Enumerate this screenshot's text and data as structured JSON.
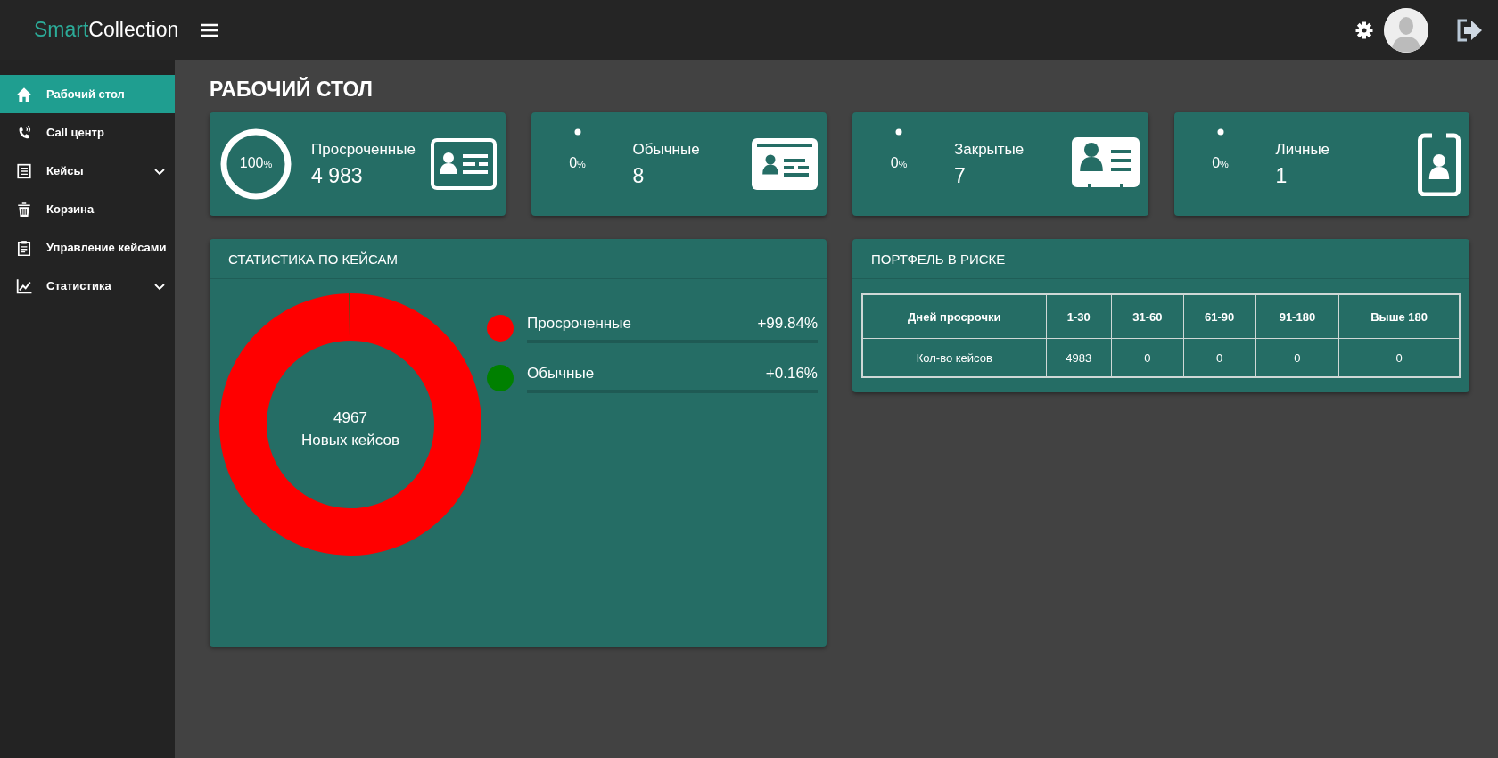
{
  "header": {
    "logo_first": "Smart",
    "logo_second": "Collection"
  },
  "sidebar": {
    "items": [
      {
        "label": "Рабочий стол",
        "kind": "link",
        "selected": true
      },
      {
        "label": "Call центр",
        "kind": "link",
        "selected": false
      },
      {
        "label": "Кейсы",
        "kind": "group",
        "selected": false,
        "expanded": false
      },
      {
        "label": "Корзина",
        "kind": "link",
        "selected": false
      },
      {
        "label": "Управление кейсами",
        "kind": "link",
        "selected": false
      },
      {
        "label": "Статистика",
        "kind": "group",
        "selected": false,
        "expanded": false
      }
    ]
  },
  "page_title": "РАБОЧИЙ СТОЛ",
  "stat_cards": [
    {
      "percent": "100",
      "unit": "%",
      "level": 1,
      "label": "Просроченные",
      "value": "4 983"
    },
    {
      "percent": "0",
      "unit": "%",
      "level": 0,
      "label": "Обычные",
      "value": "8"
    },
    {
      "percent": "0",
      "unit": "%",
      "level": 0,
      "label": "Закрытые",
      "value": "7"
    },
    {
      "percent": "0",
      "unit": "%",
      "level": 0,
      "label": "Личные",
      "value": "1"
    }
  ],
  "case_stats": {
    "title": "СТАТИСТИКА ПО КЕЙСАМ",
    "center_value": "4967",
    "center_label": "Новых кейсов",
    "chart_data": {
      "type": "donut",
      "categories": [
        "Просроченные",
        "Обычные"
      ],
      "values": [
        99.84,
        0.16
      ]
    },
    "legend": [
      {
        "value": "+99.84%",
        "color": "#ff0000"
      },
      {
        "value": "+0.16%",
        "color": "#008000"
      }
    ]
  },
  "risk_portfolio": {
    "title": "ПОРТФЕЛЬ В РИСКЕ",
    "table": {
      "columns": [
        "Дней просрочки",
        "1-30",
        "31-60",
        "61-90",
        "91-180",
        "Выше 180"
      ],
      "rows": [
        [
          "Кол-во кейсов",
          "4983",
          "0",
          "0",
          "0",
          "0"
        ]
      ]
    }
  }
}
